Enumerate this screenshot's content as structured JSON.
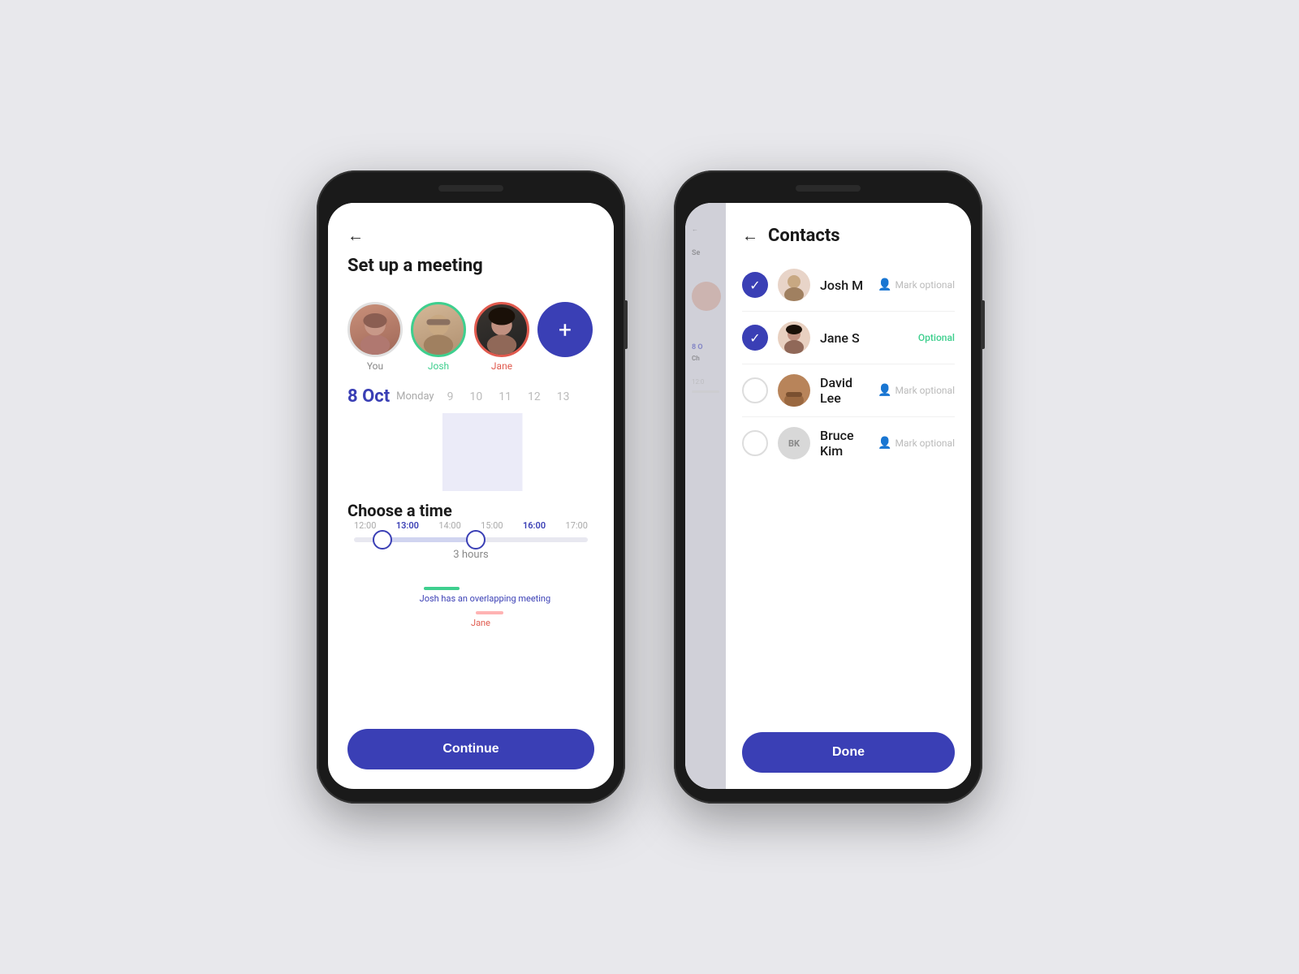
{
  "phone1": {
    "header": {
      "title": "Set up a meeting",
      "back_label": "←"
    },
    "avatars": [
      {
        "id": "you",
        "label": "You",
        "initials": "👩"
      },
      {
        "id": "josh",
        "label": "Josh",
        "initials": "🧔"
      },
      {
        "id": "jane",
        "label": "Jane",
        "initials": "👩‍🦱"
      }
    ],
    "add_button": "+",
    "calendar": {
      "current_date": "8 Oct",
      "day_name": "Monday",
      "days": [
        "9",
        "10",
        "11",
        "12",
        "13"
      ]
    },
    "time_section_title": "Choose a time",
    "time_labels": [
      "12:00",
      "13:00",
      "14:00",
      "15:00",
      "16:00",
      "17:00"
    ],
    "duration": "3 hours",
    "conflict_josh": "Josh has an overlapping meeting",
    "conflict_jane": "Jane",
    "continue_btn": "Continue"
  },
  "phone2": {
    "header": {
      "title": "Contacts",
      "back_label": "←"
    },
    "subtitle": "Se",
    "calendar_peek": "8 O",
    "time_peek": "Ch",
    "time12": "12:0",
    "contacts": [
      {
        "id": "josh_m",
        "name": "Josh M",
        "checked": true,
        "optional_label": "Mark optional"
      },
      {
        "id": "jane_s",
        "name": "Jane S",
        "checked": true,
        "optional_label": "Optional",
        "is_optional": true
      },
      {
        "id": "david_lee",
        "name": "David Lee",
        "checked": false,
        "has_avatar": true,
        "optional_label": "Mark optional"
      },
      {
        "id": "bruce_kim",
        "name": "Bruce Kim",
        "checked": false,
        "initials": "BK",
        "optional_label": "Mark optional"
      }
    ],
    "done_btn": "Done"
  }
}
